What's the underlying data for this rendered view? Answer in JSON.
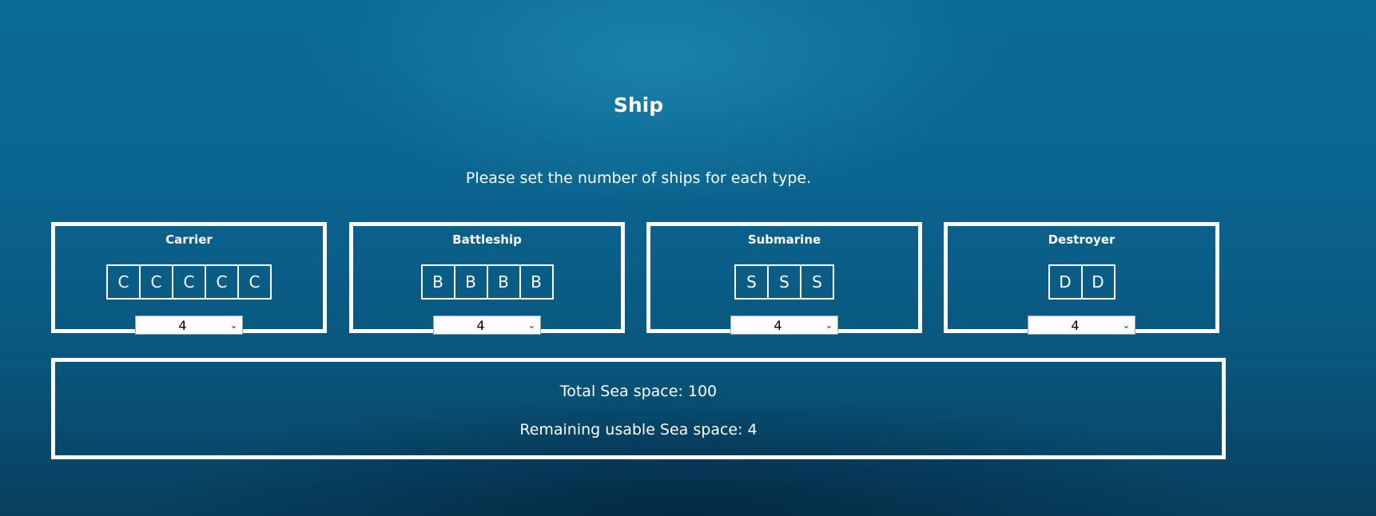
{
  "page": {
    "title": "Ship",
    "instructions": "Please set the number of ships for each type."
  },
  "ships": [
    {
      "name": "Carrier",
      "letter": "C",
      "cells": [
        "C",
        "C",
        "C",
        "C",
        "C"
      ],
      "count": "4"
    },
    {
      "name": "Battleship",
      "letter": "B",
      "cells": [
        "B",
        "B",
        "B",
        "B"
      ],
      "count": "4"
    },
    {
      "name": "Submarine",
      "letter": "S",
      "cells": [
        "S",
        "S",
        "S"
      ],
      "count": "4"
    },
    {
      "name": "Destroyer",
      "letter": "D",
      "cells": [
        "D",
        "D"
      ],
      "count": "4"
    }
  ],
  "summary": {
    "total_line": "Total Sea space: 100",
    "remaining_line": "Remaining usable Sea space: 4"
  },
  "icons": {
    "select_arrow": "chevron-down-icon"
  },
  "colors": {
    "sea_background": "#0a6590",
    "border": "#ffffff",
    "text": "#ffffff"
  }
}
